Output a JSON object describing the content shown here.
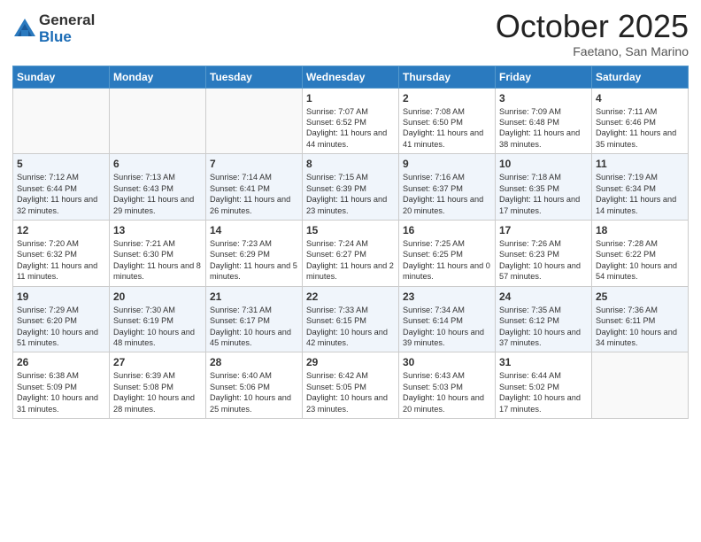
{
  "header": {
    "logo_general": "General",
    "logo_blue": "Blue",
    "month_title": "October 2025",
    "location": "Faetano, San Marino"
  },
  "days_of_week": [
    "Sunday",
    "Monday",
    "Tuesday",
    "Wednesday",
    "Thursday",
    "Friday",
    "Saturday"
  ],
  "weeks": [
    [
      {
        "day": "",
        "sunrise": "",
        "sunset": "",
        "daylight": ""
      },
      {
        "day": "",
        "sunrise": "",
        "sunset": "",
        "daylight": ""
      },
      {
        "day": "",
        "sunrise": "",
        "sunset": "",
        "daylight": ""
      },
      {
        "day": "1",
        "sunrise": "Sunrise: 7:07 AM",
        "sunset": "Sunset: 6:52 PM",
        "daylight": "Daylight: 11 hours and 44 minutes."
      },
      {
        "day": "2",
        "sunrise": "Sunrise: 7:08 AM",
        "sunset": "Sunset: 6:50 PM",
        "daylight": "Daylight: 11 hours and 41 minutes."
      },
      {
        "day": "3",
        "sunrise": "Sunrise: 7:09 AM",
        "sunset": "Sunset: 6:48 PM",
        "daylight": "Daylight: 11 hours and 38 minutes."
      },
      {
        "day": "4",
        "sunrise": "Sunrise: 7:11 AM",
        "sunset": "Sunset: 6:46 PM",
        "daylight": "Daylight: 11 hours and 35 minutes."
      }
    ],
    [
      {
        "day": "5",
        "sunrise": "Sunrise: 7:12 AM",
        "sunset": "Sunset: 6:44 PM",
        "daylight": "Daylight: 11 hours and 32 minutes."
      },
      {
        "day": "6",
        "sunrise": "Sunrise: 7:13 AM",
        "sunset": "Sunset: 6:43 PM",
        "daylight": "Daylight: 11 hours and 29 minutes."
      },
      {
        "day": "7",
        "sunrise": "Sunrise: 7:14 AM",
        "sunset": "Sunset: 6:41 PM",
        "daylight": "Daylight: 11 hours and 26 minutes."
      },
      {
        "day": "8",
        "sunrise": "Sunrise: 7:15 AM",
        "sunset": "Sunset: 6:39 PM",
        "daylight": "Daylight: 11 hours and 23 minutes."
      },
      {
        "day": "9",
        "sunrise": "Sunrise: 7:16 AM",
        "sunset": "Sunset: 6:37 PM",
        "daylight": "Daylight: 11 hours and 20 minutes."
      },
      {
        "day": "10",
        "sunrise": "Sunrise: 7:18 AM",
        "sunset": "Sunset: 6:35 PM",
        "daylight": "Daylight: 11 hours and 17 minutes."
      },
      {
        "day": "11",
        "sunrise": "Sunrise: 7:19 AM",
        "sunset": "Sunset: 6:34 PM",
        "daylight": "Daylight: 11 hours and 14 minutes."
      }
    ],
    [
      {
        "day": "12",
        "sunrise": "Sunrise: 7:20 AM",
        "sunset": "Sunset: 6:32 PM",
        "daylight": "Daylight: 11 hours and 11 minutes."
      },
      {
        "day": "13",
        "sunrise": "Sunrise: 7:21 AM",
        "sunset": "Sunset: 6:30 PM",
        "daylight": "Daylight: 11 hours and 8 minutes."
      },
      {
        "day": "14",
        "sunrise": "Sunrise: 7:23 AM",
        "sunset": "Sunset: 6:29 PM",
        "daylight": "Daylight: 11 hours and 5 minutes."
      },
      {
        "day": "15",
        "sunrise": "Sunrise: 7:24 AM",
        "sunset": "Sunset: 6:27 PM",
        "daylight": "Daylight: 11 hours and 2 minutes."
      },
      {
        "day": "16",
        "sunrise": "Sunrise: 7:25 AM",
        "sunset": "Sunset: 6:25 PM",
        "daylight": "Daylight: 11 hours and 0 minutes."
      },
      {
        "day": "17",
        "sunrise": "Sunrise: 7:26 AM",
        "sunset": "Sunset: 6:23 PM",
        "daylight": "Daylight: 10 hours and 57 minutes."
      },
      {
        "day": "18",
        "sunrise": "Sunrise: 7:28 AM",
        "sunset": "Sunset: 6:22 PM",
        "daylight": "Daylight: 10 hours and 54 minutes."
      }
    ],
    [
      {
        "day": "19",
        "sunrise": "Sunrise: 7:29 AM",
        "sunset": "Sunset: 6:20 PM",
        "daylight": "Daylight: 10 hours and 51 minutes."
      },
      {
        "day": "20",
        "sunrise": "Sunrise: 7:30 AM",
        "sunset": "Sunset: 6:19 PM",
        "daylight": "Daylight: 10 hours and 48 minutes."
      },
      {
        "day": "21",
        "sunrise": "Sunrise: 7:31 AM",
        "sunset": "Sunset: 6:17 PM",
        "daylight": "Daylight: 10 hours and 45 minutes."
      },
      {
        "day": "22",
        "sunrise": "Sunrise: 7:33 AM",
        "sunset": "Sunset: 6:15 PM",
        "daylight": "Daylight: 10 hours and 42 minutes."
      },
      {
        "day": "23",
        "sunrise": "Sunrise: 7:34 AM",
        "sunset": "Sunset: 6:14 PM",
        "daylight": "Daylight: 10 hours and 39 minutes."
      },
      {
        "day": "24",
        "sunrise": "Sunrise: 7:35 AM",
        "sunset": "Sunset: 6:12 PM",
        "daylight": "Daylight: 10 hours and 37 minutes."
      },
      {
        "day": "25",
        "sunrise": "Sunrise: 7:36 AM",
        "sunset": "Sunset: 6:11 PM",
        "daylight": "Daylight: 10 hours and 34 minutes."
      }
    ],
    [
      {
        "day": "26",
        "sunrise": "Sunrise: 6:38 AM",
        "sunset": "Sunset: 5:09 PM",
        "daylight": "Daylight: 10 hours and 31 minutes."
      },
      {
        "day": "27",
        "sunrise": "Sunrise: 6:39 AM",
        "sunset": "Sunset: 5:08 PM",
        "daylight": "Daylight: 10 hours and 28 minutes."
      },
      {
        "day": "28",
        "sunrise": "Sunrise: 6:40 AM",
        "sunset": "Sunset: 5:06 PM",
        "daylight": "Daylight: 10 hours and 25 minutes."
      },
      {
        "day": "29",
        "sunrise": "Sunrise: 6:42 AM",
        "sunset": "Sunset: 5:05 PM",
        "daylight": "Daylight: 10 hours and 23 minutes."
      },
      {
        "day": "30",
        "sunrise": "Sunrise: 6:43 AM",
        "sunset": "Sunset: 5:03 PM",
        "daylight": "Daylight: 10 hours and 20 minutes."
      },
      {
        "day": "31",
        "sunrise": "Sunrise: 6:44 AM",
        "sunset": "Sunset: 5:02 PM",
        "daylight": "Daylight: 10 hours and 17 minutes."
      },
      {
        "day": "",
        "sunrise": "",
        "sunset": "",
        "daylight": ""
      }
    ]
  ]
}
